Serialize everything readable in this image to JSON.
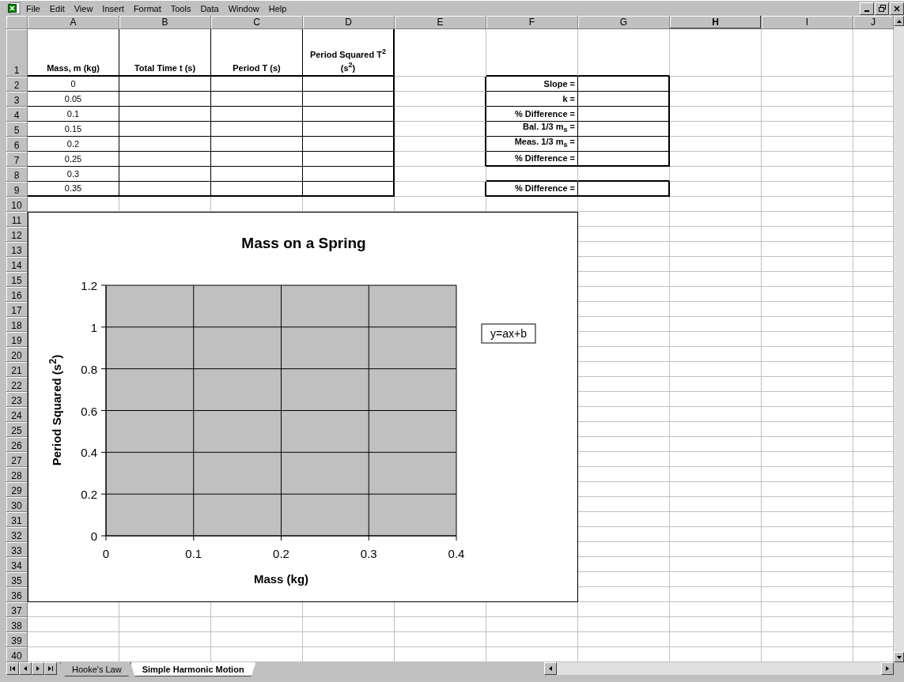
{
  "menu_bar": [
    "File",
    "Edit",
    "View",
    "Insert",
    "Format",
    "Tools",
    "Data",
    "Window",
    "Help"
  ],
  "columns": [
    {
      "label": "A",
      "selected": false
    },
    {
      "label": "B",
      "selected": false
    },
    {
      "label": "C",
      "selected": false
    },
    {
      "label": "D",
      "selected": false
    },
    {
      "label": "E",
      "selected": false
    },
    {
      "label": "F",
      "selected": false
    },
    {
      "label": "G",
      "selected": false
    },
    {
      "label": "H",
      "selected": true
    },
    {
      "label": "I",
      "selected": false
    },
    {
      "label": "J",
      "selected": false
    }
  ],
  "row_numbers": [
    "1",
    "2",
    "3",
    "4",
    "5",
    "6",
    "7",
    "8",
    "9",
    "10",
    "11",
    "12",
    "13",
    "14",
    "15",
    "16",
    "17",
    "18",
    "19",
    "20",
    "21",
    "22",
    "23",
    "24",
    "25",
    "26",
    "27",
    "28",
    "29",
    "30",
    "31",
    "32",
    "33",
    "34",
    "35",
    "36",
    "37",
    "38",
    "39",
    "40"
  ],
  "table": {
    "columns": [
      "Mass, m (kg)",
      "Total Time t (s)",
      "Period T (s)",
      "Period Squared T$^{2}$ (s$^{2}$)"
    ],
    "rows": [
      "0",
      "0.05",
      "0.1",
      "0.15",
      "0.2",
      "0.25",
      "0.3",
      "0.35"
    ]
  },
  "result_boxes": [
    [
      "Slope =",
      "k =",
      "% Difference =",
      "Bal. 1/3 m$_{s}$ =",
      "Meas. 1/3 m$_{s}$ =",
      "% Difference ="
    ],
    [
      "% Difference ="
    ]
  ],
  "chart": {
    "chart_data": {
      "type": "scatter",
      "title": "Mass on a Spring",
      "xlabel": "Mass (kg)",
      "ylabel": "Period Squared (s$^{2}$)",
      "xlim": [
        0,
        0.4
      ],
      "ylim": [
        0,
        1.2
      ],
      "xticks": [
        {
          "value": 0,
          "label": "0"
        },
        {
          "value": 0.1,
          "label": "0.1"
        },
        {
          "value": 0.2,
          "label": "0.2"
        },
        {
          "value": 0.3,
          "label": "0.3"
        },
        {
          "value": 0.4,
          "label": "0.4"
        }
      ],
      "yticks": [
        {
          "value": 0,
          "label": "0"
        },
        {
          "value": 0.2,
          "label": "0.2"
        },
        {
          "value": 0.4,
          "label": "0.4"
        },
        {
          "value": 0.6,
          "label": "0.6"
        },
        {
          "value": 0.8,
          "label": "0.8"
        },
        {
          "value": 1,
          "label": "1"
        },
        {
          "value": 1.2,
          "label": "1.2"
        }
      ],
      "grid": true,
      "annotations": [
        "y=ax+b"
      ]
    }
  },
  "sheet_tabs": [
    {
      "label": "Hooke's Law",
      "selected": false
    },
    {
      "label": "Simple Harmonic Motion",
      "selected": true
    }
  ]
}
